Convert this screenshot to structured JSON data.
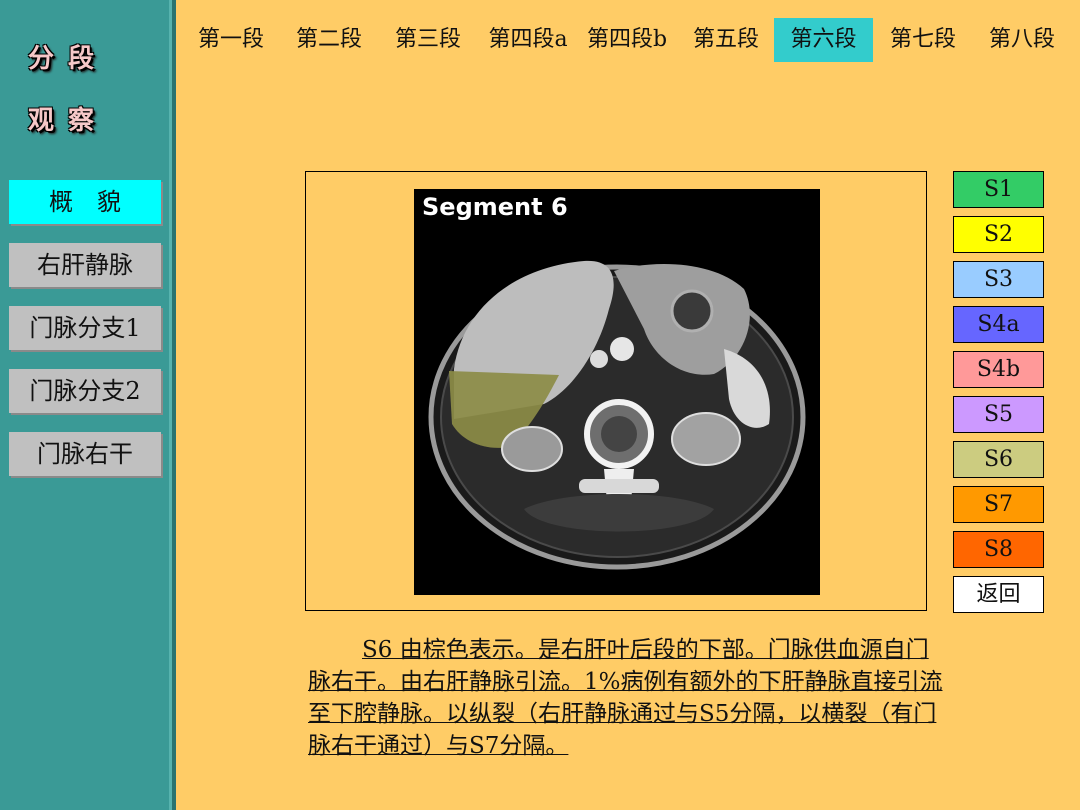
{
  "sidebar": {
    "logo_line1": "分段",
    "logo_line2": "观察",
    "items": [
      {
        "label": "概　貌",
        "active": true
      },
      {
        "label": "右肝静脉",
        "active": false
      },
      {
        "label": "门脉分支1",
        "active": false
      },
      {
        "label": "门脉分支2",
        "active": false
      },
      {
        "label": "门脉右干",
        "active": false
      }
    ]
  },
  "tabs": [
    {
      "label": "第一段"
    },
    {
      "label": "第二段"
    },
    {
      "label": "第三段"
    },
    {
      "label": "第四段a"
    },
    {
      "label": "第四段b"
    },
    {
      "label": "第五段"
    },
    {
      "label": "第六段",
      "active": true
    },
    {
      "label": "第七段"
    },
    {
      "label": "第八段"
    }
  ],
  "image": {
    "title": "Segment 6",
    "highlight_color": "#8c8c46"
  },
  "segments": [
    {
      "label": "S1",
      "color": "#33cc66"
    },
    {
      "label": "S2",
      "color": "#ffff00"
    },
    {
      "label": "S3",
      "color": "#99ccff"
    },
    {
      "label": "S4a",
      "color": "#6666ff"
    },
    {
      "label": "S4b",
      "color": "#ff9999"
    },
    {
      "label": "S5",
      "color": "#cc99ff"
    },
    {
      "label": "S6",
      "color": "#cccc80"
    },
    {
      "label": "S7",
      "color": "#ff9900"
    },
    {
      "label": "S8",
      "color": "#ff6600"
    },
    {
      "label": "返回",
      "color": "#ffffff"
    }
  ],
  "description": "S6 由棕色表示。是右肝叶后段的下部。门脉供血源自门脉右干。由右肝静脉引流。1%病例有额外的下肝静脉直接引流至下腔静脉。以纵裂（右肝静脉通过与S5分隔，以横裂（有门脉右干通过）与S7分隔。"
}
